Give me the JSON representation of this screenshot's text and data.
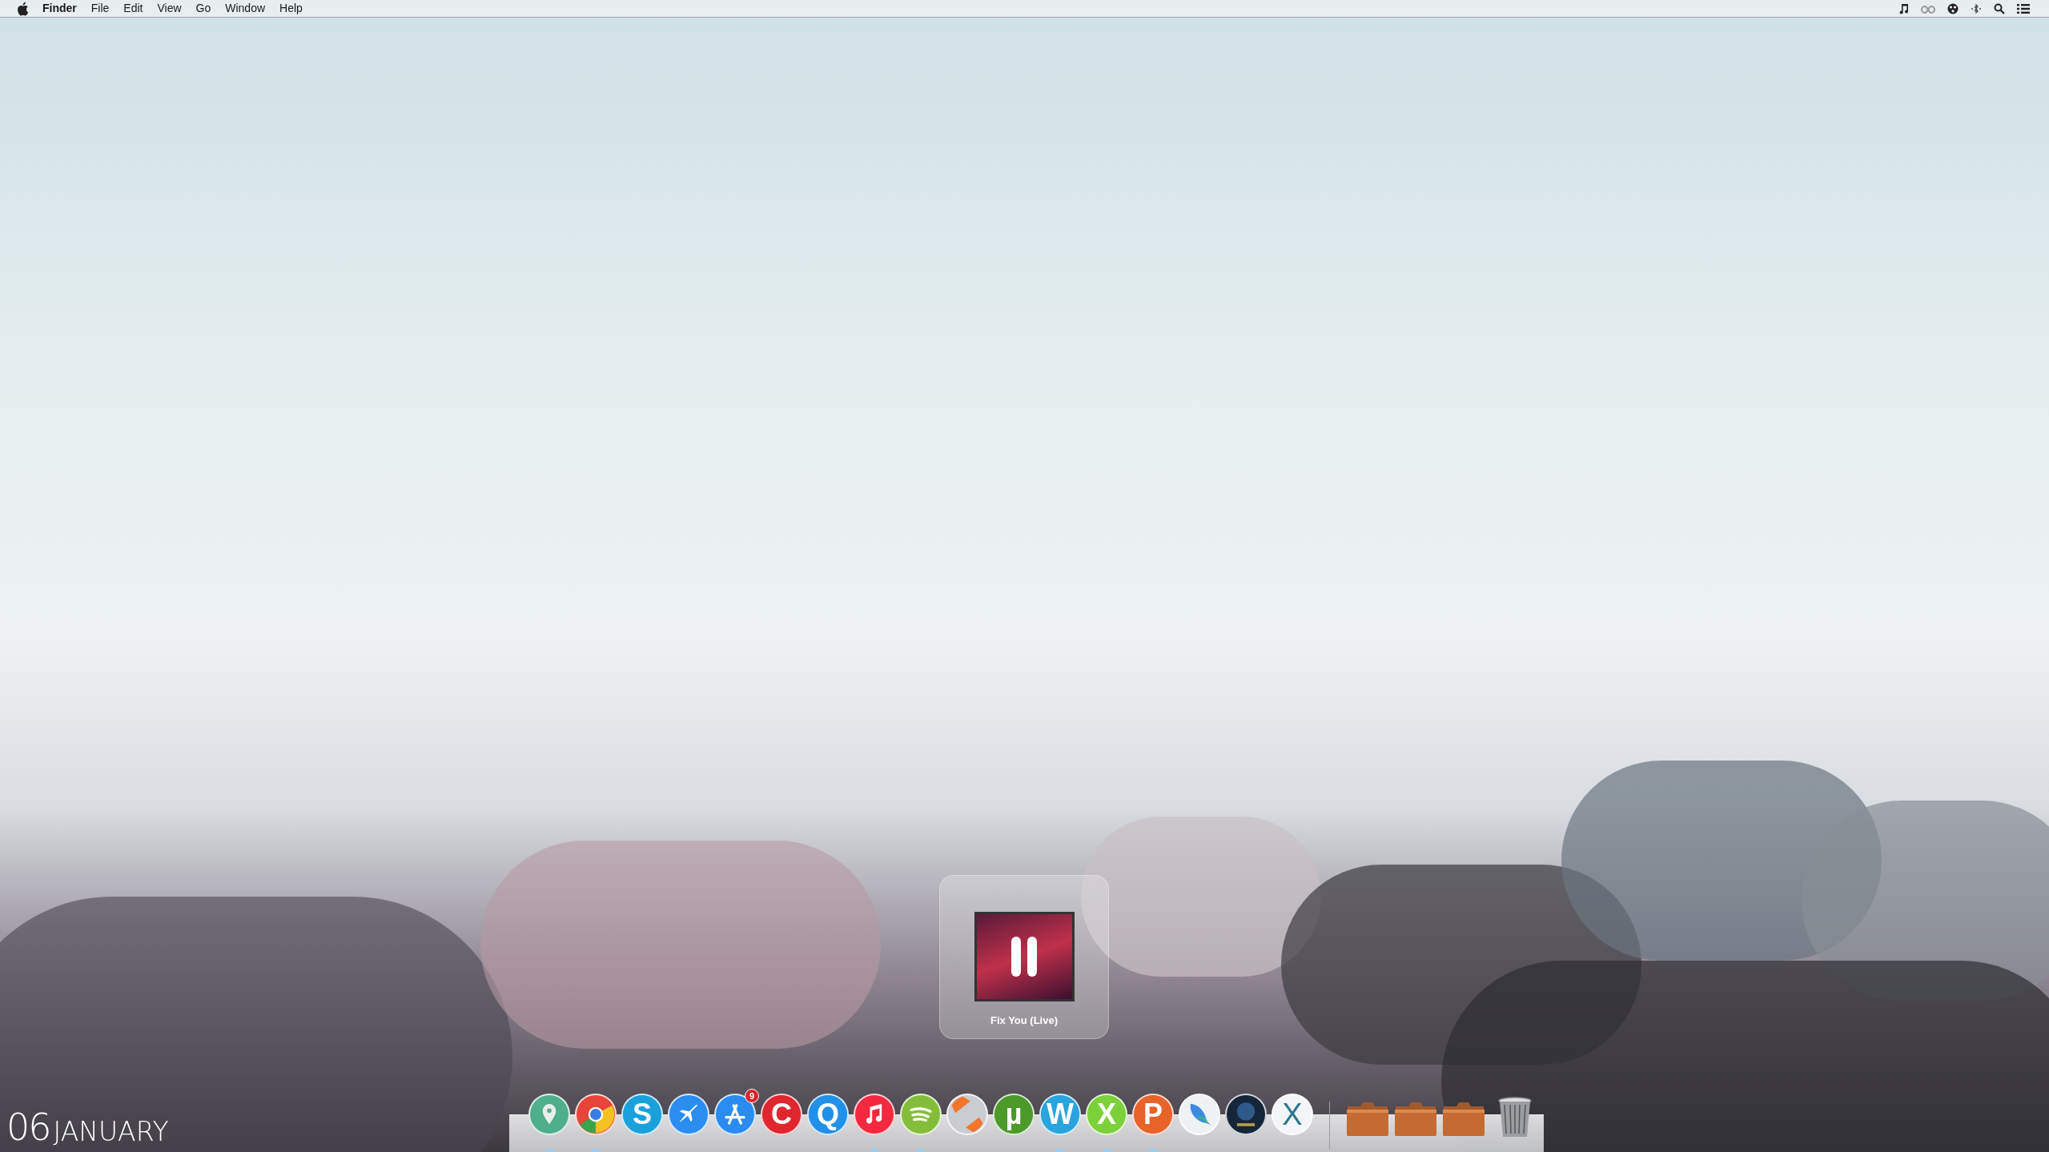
{
  "menu_bar": {
    "app_name": "Finder",
    "menus": [
      "File",
      "Edit",
      "View",
      "Go",
      "Window",
      "Help"
    ]
  },
  "now_playing": {
    "title": "Fix You (Live)",
    "paused": true
  },
  "dock": {
    "apps": [
      {
        "kind": "pin",
        "color": "#4fae8c",
        "running": true
      },
      {
        "kind": "ring",
        "color": "#e8443a",
        "running": true
      },
      {
        "kind": "glyph",
        "glyph": "S",
        "color": "#1aa1db",
        "running": false
      },
      {
        "kind": "plane",
        "color": "#2c8df0",
        "running": false
      },
      {
        "kind": "appstore",
        "color": "#2a8cf0",
        "running": false,
        "badge": "9"
      },
      {
        "kind": "glyph",
        "glyph": "C",
        "color": "#e0262e",
        "running": false
      },
      {
        "kind": "glyph",
        "glyph": "Q",
        "color": "#2190ea",
        "running": false
      },
      {
        "kind": "note",
        "color": "#f4293f",
        "running": true
      },
      {
        "kind": "waves",
        "color": "#84bd3a",
        "running": true
      },
      {
        "kind": "stripes",
        "color": "#c9ccd0",
        "running": false
      },
      {
        "kind": "glyph",
        "glyph": "µ",
        "color": "#4c9a2a",
        "running": false
      },
      {
        "kind": "glyph",
        "glyph": "W",
        "color": "#2aa4de",
        "running": true
      },
      {
        "kind": "glyph",
        "glyph": "X",
        "color": "#7cd13a",
        "running": true
      },
      {
        "kind": "glyph",
        "glyph": "P",
        "color": "#e8632a",
        "running": true
      },
      {
        "kind": "feather",
        "color": "#eef2f5",
        "running": false
      },
      {
        "kind": "picture",
        "color": "#16263a",
        "running": false
      },
      {
        "kind": "thin-glyph",
        "glyph": "X",
        "color": "#f3f5f6",
        "running": false
      }
    ],
    "stacks": [
      {
        "kind": "folder"
      },
      {
        "kind": "folder"
      },
      {
        "kind": "folder"
      },
      {
        "kind": "trash"
      }
    ]
  },
  "date": {
    "day": "06",
    "month": "JANUARY"
  }
}
